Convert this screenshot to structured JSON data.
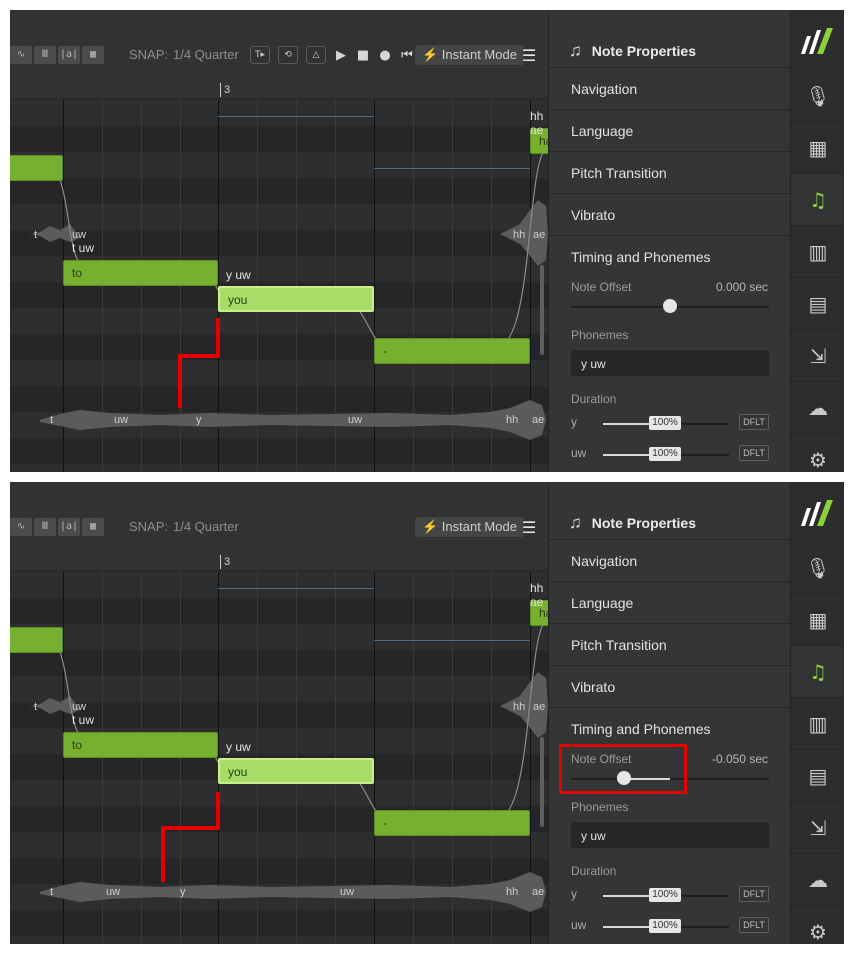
{
  "toolbar": {
    "snap_label": "SNAP:",
    "snap_value": "1/4 Quarter",
    "instant_mode": "⚡ Instant Mode",
    "menu_icon": "hamburger-menu-icon"
  },
  "ruler": {
    "bar_number": "3"
  },
  "notes": [
    {
      "lyric": "to",
      "phonemes": "t uw"
    },
    {
      "lyric": "you",
      "phonemes": "y uw"
    },
    {
      "lyric": "-",
      "phonemes": ""
    },
    {
      "lyric": "ha",
      "phonemes": "hh ae"
    }
  ],
  "waveform_labels": {
    "upper": [
      "t",
      "uw",
      "hh",
      "ae"
    ],
    "lower_before": [
      "t",
      "uw",
      "y",
      "uw",
      "hh",
      "ae"
    ],
    "lower_after": [
      "t",
      "uw",
      "y",
      "uw",
      "hh",
      "ae"
    ]
  },
  "panel_title": "Note Properties",
  "sections": [
    "Navigation",
    "Language",
    "Pitch Transition",
    "Vibrato",
    "Timing and Phonemes"
  ],
  "before": {
    "note_offset_label": "Note Offset",
    "note_offset_value": "0.000 sec",
    "note_offset_fraction": 0.5
  },
  "after": {
    "note_offset_label": "Note Offset",
    "note_offset_value": "-0.050 sec",
    "note_offset_fraction": 0.27
  },
  "phonemes_label": "Phonemes",
  "phonemes_value": "y uw",
  "duration_label": "Duration",
  "durations": [
    {
      "phoneme": "y",
      "percent": "100%",
      "default_label": "DFLT"
    },
    {
      "phoneme": "uw",
      "percent": "100%",
      "default_label": "DFLT"
    }
  ],
  "rail_icons": [
    "synthv-logo-icon",
    "microphone-icon",
    "clapperboard-icon",
    "music-note-icon",
    "library-icon",
    "book-icon",
    "render-export-icon",
    "cloud-check-icon",
    "gear-icon"
  ],
  "colors": {
    "note": "#76b02e",
    "note_selected": "#a7dc66",
    "annotation": "#e50000",
    "active_icon": "#8bd13a"
  }
}
